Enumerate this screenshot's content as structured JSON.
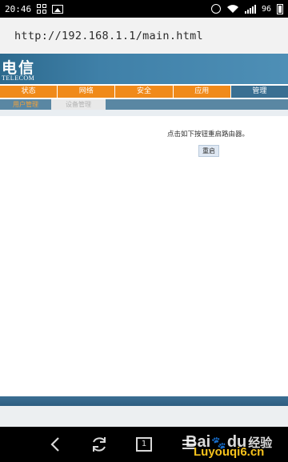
{
  "status_bar": {
    "time": "20:46",
    "battery_level": "96",
    "icons": [
      "grid-icon",
      "picture-icon",
      "alarm-icon",
      "wifi-icon",
      "signal-icon",
      "battery-icon"
    ]
  },
  "browser": {
    "url": "http://192.168.1.1/main.html"
  },
  "router_page": {
    "brand_cn": "电信",
    "brand_en": "TELECOM",
    "nav_tabs": [
      {
        "label": "状态",
        "active": false
      },
      {
        "label": "网络",
        "active": false
      },
      {
        "label": "安全",
        "active": false
      },
      {
        "label": "应用",
        "active": false
      },
      {
        "label": "管理",
        "active": true
      }
    ],
    "sub_nav": [
      {
        "label": "用户管理",
        "current": true
      },
      {
        "label": "设备管理",
        "current": false
      }
    ],
    "instruction": "点击如下按钮重启路由器。",
    "reboot_button": "重启"
  },
  "bottom_nav": {
    "tabs_count": "1"
  },
  "watermark": {
    "line1_bai": "Bai",
    "line1_du": "du",
    "line1_jingyan": "经验",
    "line2": "Luyouqi6.cn"
  },
  "colors": {
    "banner": "#3f80a8",
    "nav_tab": "#f08a1a",
    "nav_tab_active": "#3a6f92",
    "sub_nav_bg": "#5a87a3",
    "sub_nav_current_text": "#f3a23a",
    "watermark_paw": "#e3362c",
    "watermark_line2": "#f6c21c"
  }
}
